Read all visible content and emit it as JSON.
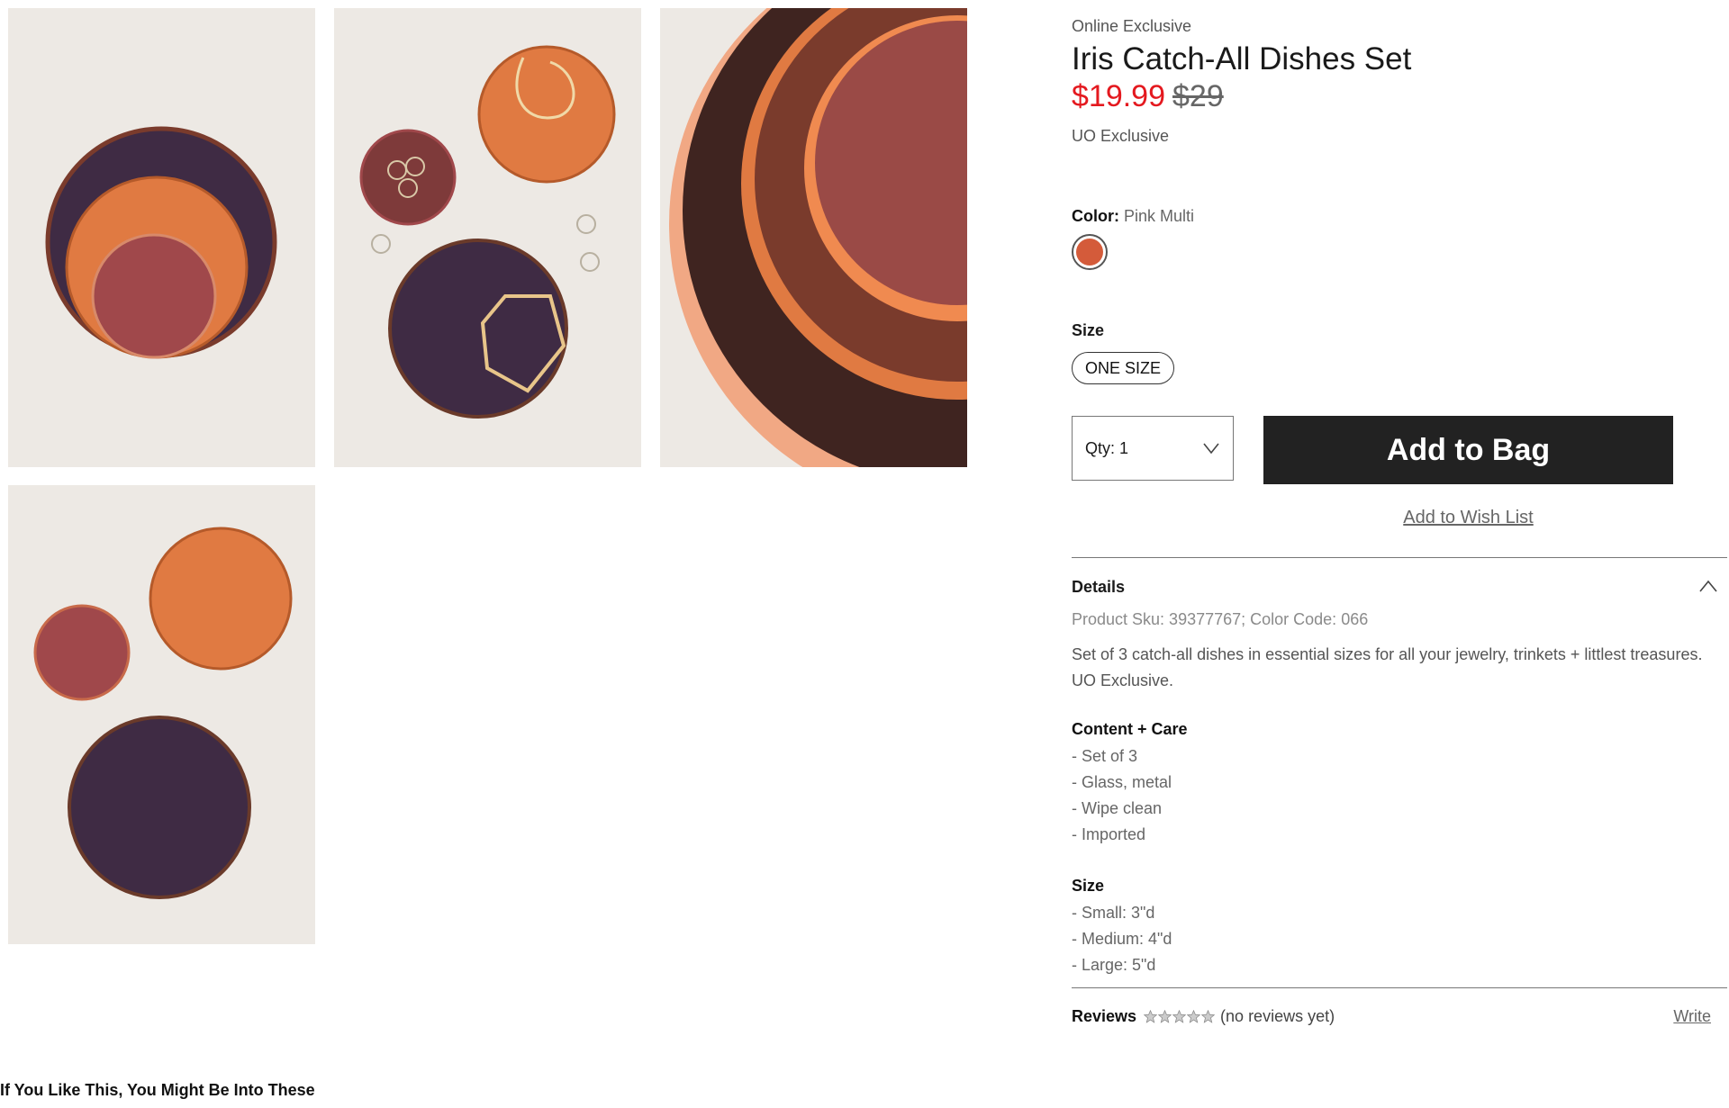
{
  "gallery": {
    "images": [
      {
        "name": "product-image-1",
        "alt": "Three nested dishes"
      },
      {
        "name": "product-image-2",
        "alt": "Dishes holding jewelry"
      },
      {
        "name": "product-image-3",
        "alt": "Close-up of dish rims"
      },
      {
        "name": "product-image-4",
        "alt": "Three dishes arranged separately"
      }
    ],
    "colors": {
      "background": "#ede9e4",
      "purple": "#3f2b44",
      "orange": "#e07a42",
      "rose": "#a0484b",
      "copper": "#f1a884"
    }
  },
  "product": {
    "eyebrow": "Online Exclusive",
    "title": "Iris Catch-All Dishes Set",
    "price_sale": "$19.99",
    "price_original": "$29",
    "exclusive_label": "UO Exclusive",
    "color_label": "Color:",
    "color_value": "Pink Multi",
    "swatch_color": "#d45b3a",
    "size_label": "Size",
    "size_option": "ONE SIZE",
    "qty_label": "Qty: 1",
    "add_to_bag": "Add to Bag",
    "add_to_wishlist": "Add to Wish List"
  },
  "details": {
    "heading": "Details",
    "sku_line": "Product Sku: 39377767; Color Code: 066",
    "description": "Set of 3 catch-all dishes in essential sizes for all your jewelry, trinkets + littlest treasures. UO Exclusive.",
    "content_heading": "Content + Care",
    "content_items": [
      "- Set of 3",
      "- Glass, metal",
      "- Wipe clean",
      "- Imported"
    ],
    "size_heading": "Size",
    "size_items": [
      "- Small: 3\"d",
      "- Medium: 4\"d",
      "- Large: 5\"d"
    ]
  },
  "reviews": {
    "heading": "Reviews",
    "rating": 0,
    "status": "(no reviews yet)",
    "write_label": "Write"
  },
  "recommendations": {
    "heading": "If You Like This, You Might Be Into These"
  }
}
